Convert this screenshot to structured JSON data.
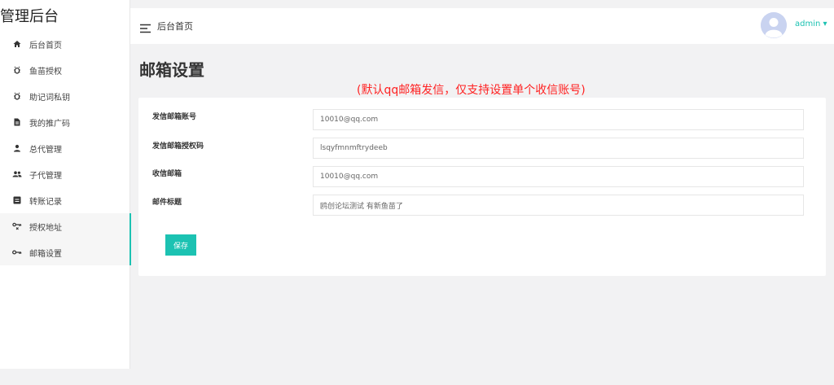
{
  "app": {
    "brand": "管理后台"
  },
  "sidebar": {
    "items": [
      {
        "label": "后台首页",
        "icon": "home-icon"
      },
      {
        "label": "鱼苗授权",
        "icon": "bug-icon"
      },
      {
        "label": "助记词私钥",
        "icon": "bug-icon"
      },
      {
        "label": "我的推广码",
        "icon": "file-icon"
      },
      {
        "label": "总代管理",
        "icon": "user-icon"
      },
      {
        "label": "子代管理",
        "icon": "users-icon"
      },
      {
        "label": "转账记录",
        "icon": "list-icon"
      },
      {
        "label": "授权地址",
        "icon": "key-icon"
      },
      {
        "label": "邮箱设置",
        "icon": "key-icon"
      }
    ]
  },
  "header": {
    "breadcrumb": "后台首页",
    "user": {
      "name": "admin",
      "caret": "▾"
    }
  },
  "page": {
    "title": "邮箱设置",
    "notice": "(默认qq邮箱发信，仅支持设置单个收信账号)"
  },
  "form": {
    "fields": [
      {
        "label": "发信邮箱账号",
        "value": "10010@qq.com"
      },
      {
        "label": "发信邮箱授权码",
        "value": "lsqyfmnmftrydeeb"
      },
      {
        "label": "收信邮箱",
        "value": "10010@qq.com"
      },
      {
        "label": "邮件标题",
        "value": "鸥创论坛测试 有新鱼苗了"
      }
    ],
    "save_label": "保存"
  },
  "colors": {
    "accent": "#1cc2b2",
    "notice": "#ff2222"
  }
}
